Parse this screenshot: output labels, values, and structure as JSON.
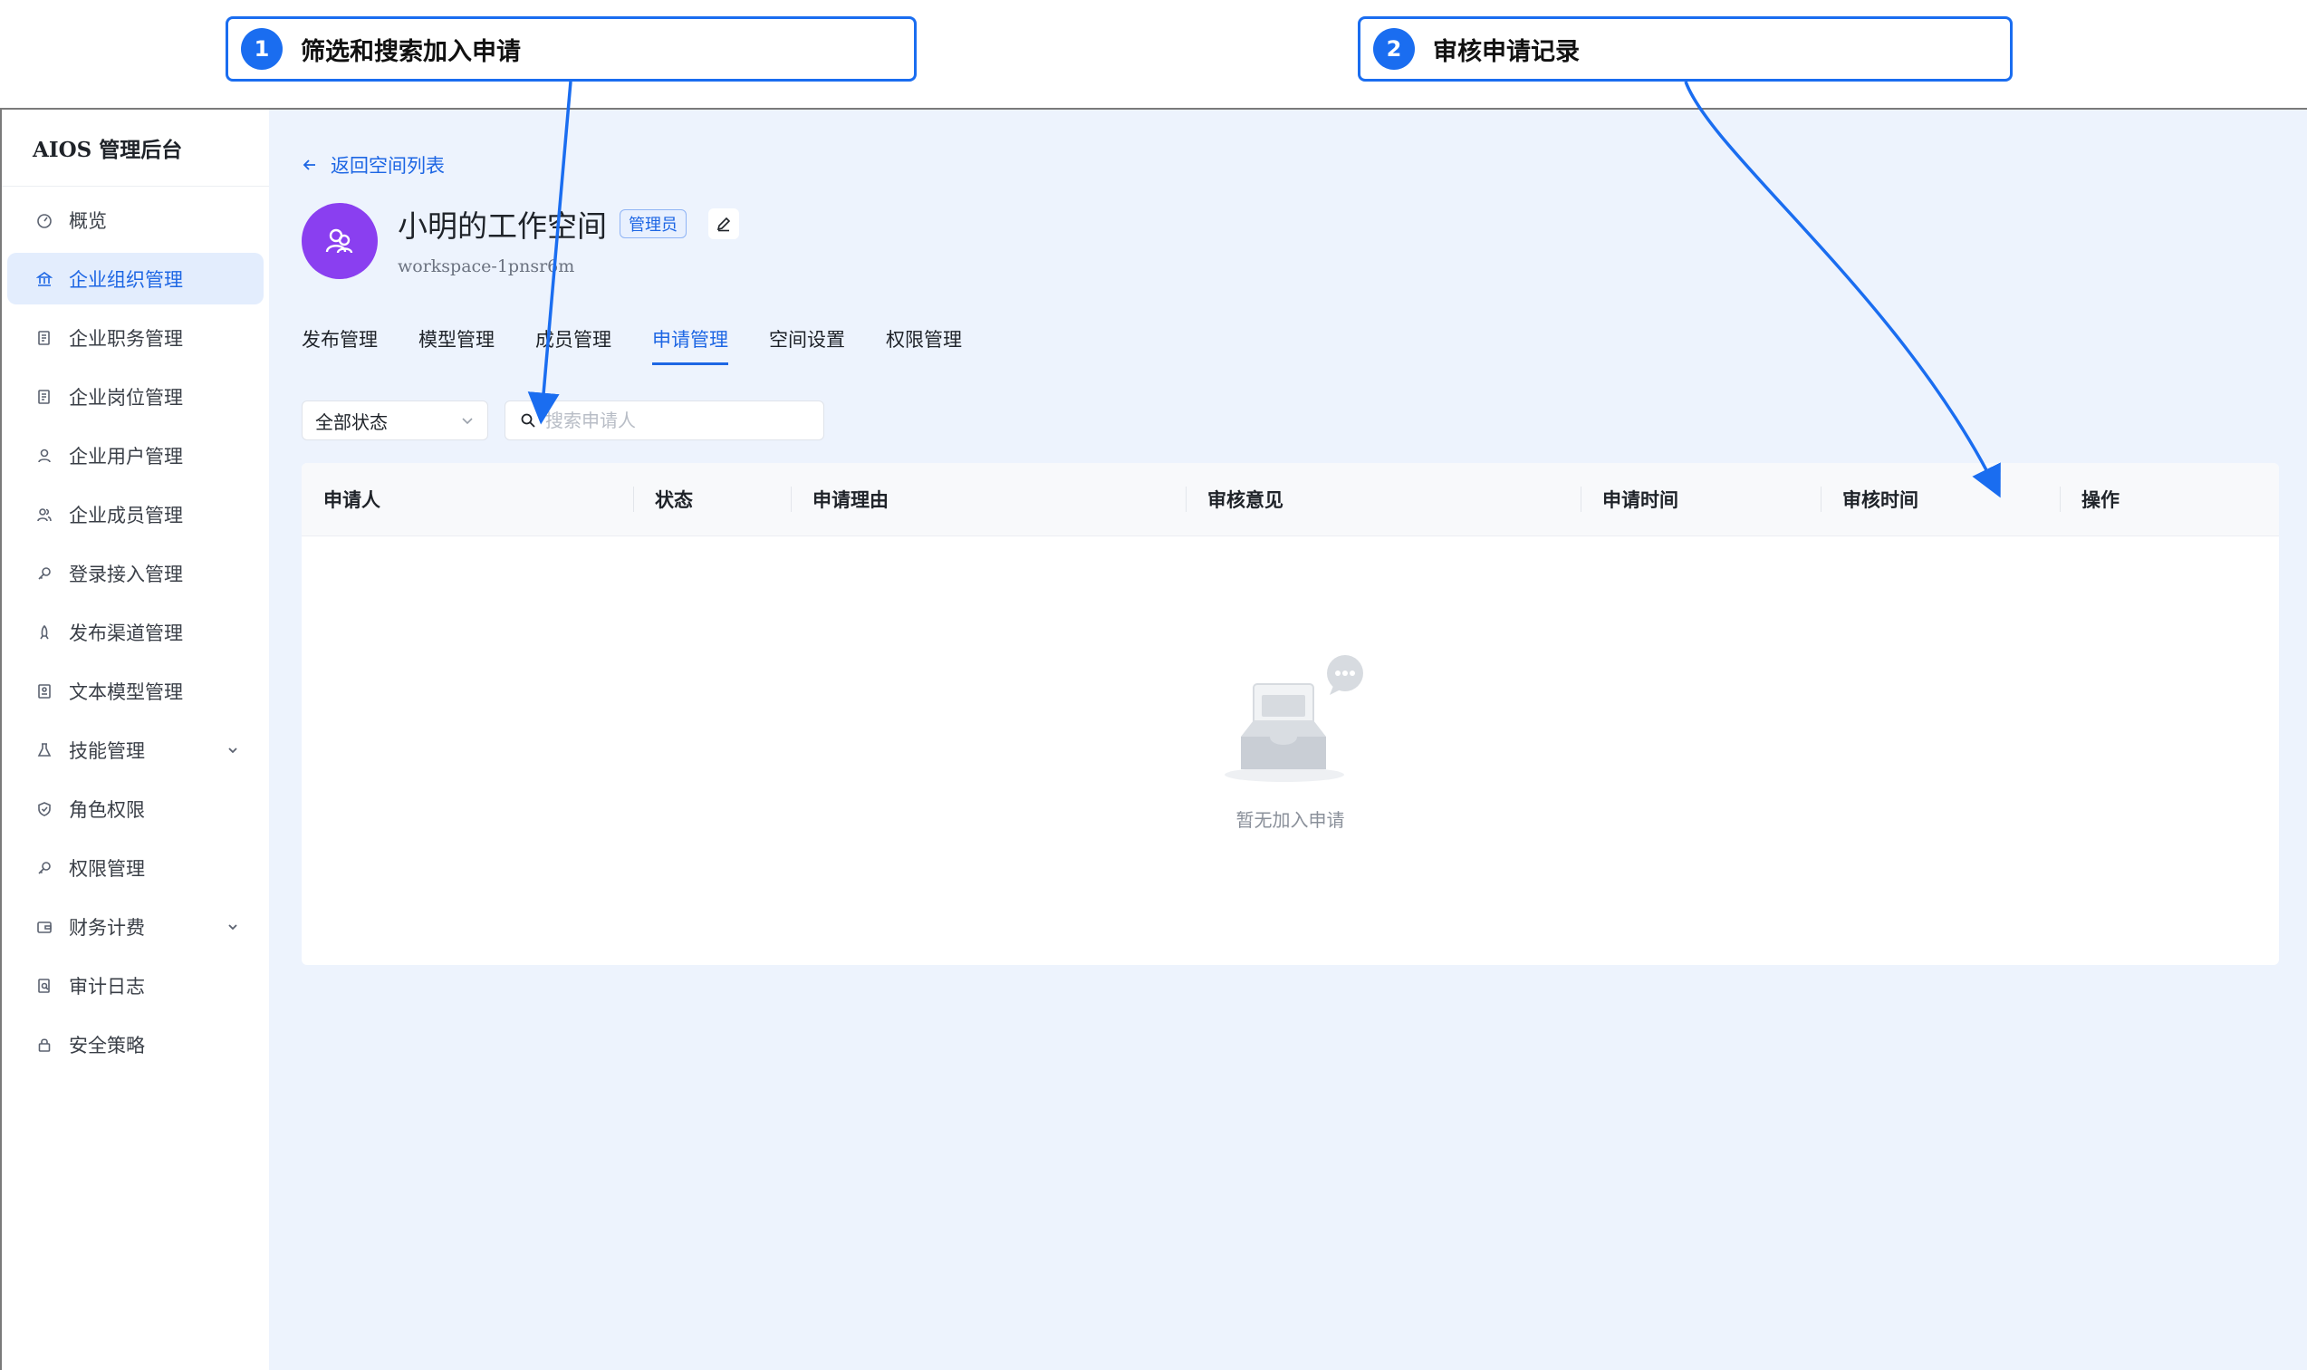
{
  "annotations": [
    {
      "number": "1",
      "text": "筛选和搜索加入申请"
    },
    {
      "number": "2",
      "text": "审核申请记录"
    }
  ],
  "app": {
    "brand": "AIOS 管理后台",
    "sidebar": {
      "items": [
        {
          "label": "概览",
          "icon": "dashboard-icon"
        },
        {
          "label": "企业组织管理",
          "icon": "bank-icon",
          "active": true
        },
        {
          "label": "企业职务管理",
          "icon": "document-icon"
        },
        {
          "label": "企业岗位管理",
          "icon": "document-icon"
        },
        {
          "label": "企业用户管理",
          "icon": "user-icon"
        },
        {
          "label": "企业成员管理",
          "icon": "users-icon"
        },
        {
          "label": "登录接入管理",
          "icon": "key-icon"
        },
        {
          "label": "发布渠道管理",
          "icon": "rocket-icon"
        },
        {
          "label": "文本模型管理",
          "icon": "model-icon"
        },
        {
          "label": "技能管理",
          "icon": "flask-icon",
          "expandable": true
        },
        {
          "label": "角色权限",
          "icon": "shield-icon"
        },
        {
          "label": "权限管理",
          "icon": "key-icon"
        },
        {
          "label": "财务计费",
          "icon": "wallet-icon",
          "expandable": true
        },
        {
          "label": "审计日志",
          "icon": "audit-icon"
        },
        {
          "label": "安全策略",
          "icon": "lock-icon"
        }
      ]
    },
    "main": {
      "back_label": "返回空间列表",
      "workspace": {
        "title": "小明的工作空间",
        "role_badge": "管理员",
        "id": "workspace-1pnsr6m"
      },
      "tabs": [
        {
          "label": "发布管理"
        },
        {
          "label": "模型管理"
        },
        {
          "label": "成员管理"
        },
        {
          "label": "申请管理",
          "active": true
        },
        {
          "label": "空间设置"
        },
        {
          "label": "权限管理"
        }
      ],
      "filter": {
        "status_selected": "全部状态"
      },
      "search": {
        "placeholder": "搜索申请人",
        "value": ""
      },
      "table": {
        "columns": [
          "申请人",
          "状态",
          "申请理由",
          "审核意见",
          "申请时间",
          "审核时间",
          "操作"
        ],
        "rows": [],
        "empty_text": "暂无加入申请"
      }
    }
  },
  "colors": {
    "accent": "#1d66e4",
    "annotation": "#1a6df0",
    "avatar": "#8a3ff0",
    "background": "#edf3fd"
  }
}
